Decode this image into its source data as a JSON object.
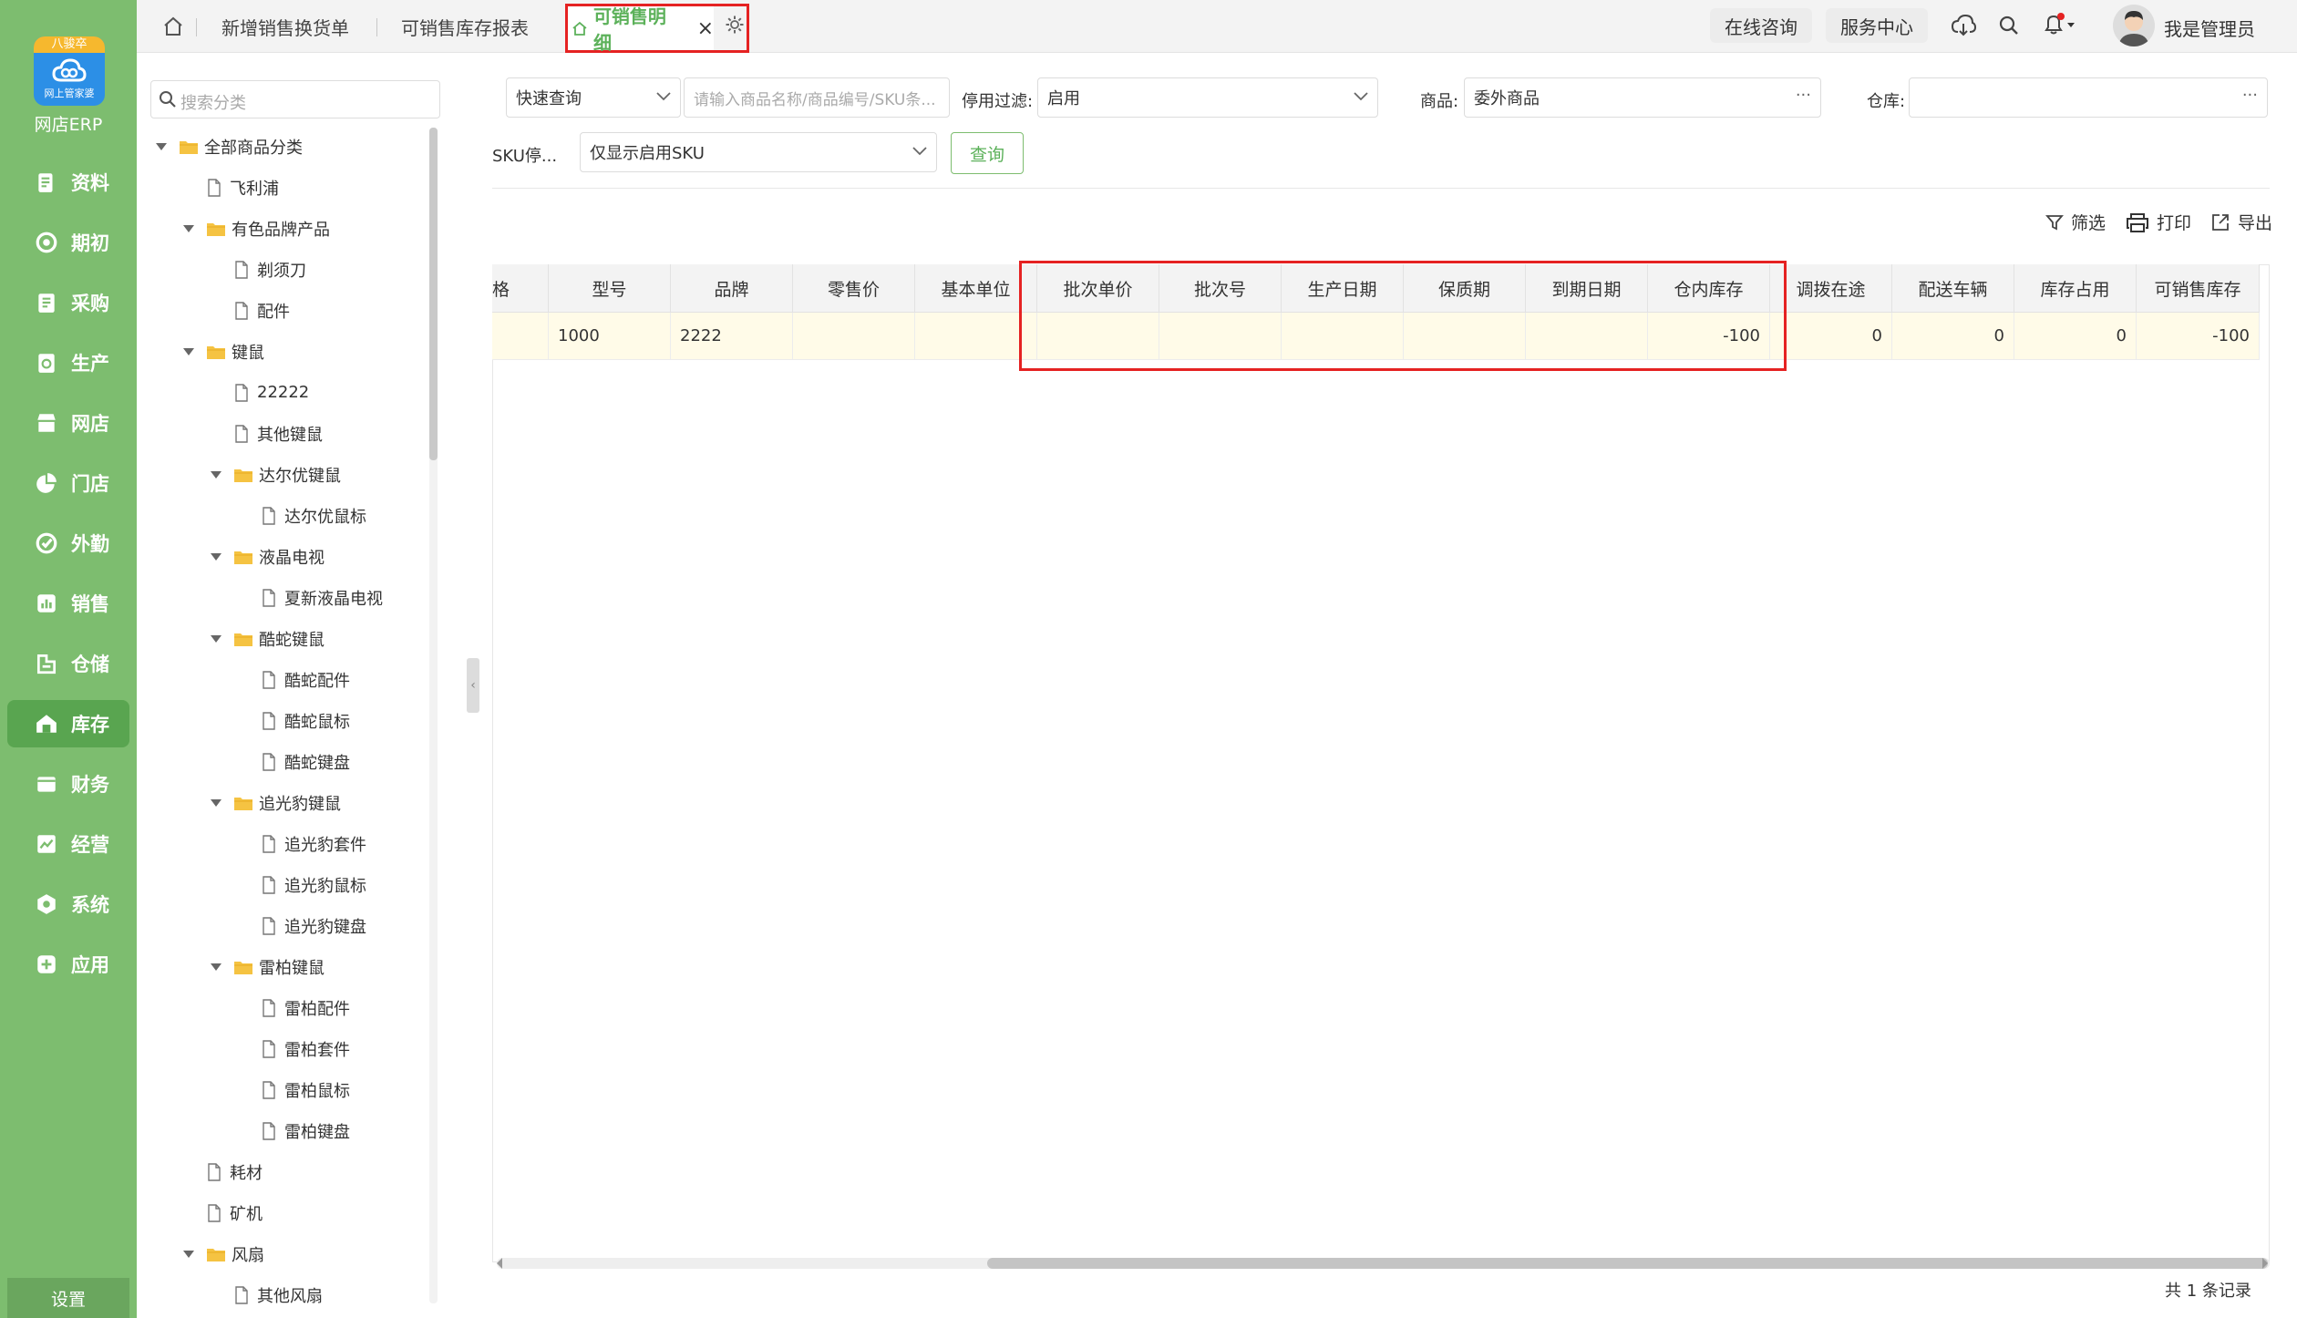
{
  "app": {
    "logo_top": "八骏卒",
    "logo_sub": "网上管家婆",
    "name": "网店ERP"
  },
  "nav": [
    {
      "label": "资料",
      "icon": "document-icon"
    },
    {
      "label": "期初",
      "icon": "target-icon"
    },
    {
      "label": "采购",
      "icon": "purchase-icon"
    },
    {
      "label": "生产",
      "icon": "production-icon"
    },
    {
      "label": "网店",
      "icon": "store-icon"
    },
    {
      "label": "门店",
      "icon": "pie-icon"
    },
    {
      "label": "外勤",
      "icon": "field-icon"
    },
    {
      "label": "销售",
      "icon": "sales-chart-icon"
    },
    {
      "label": "仓储",
      "icon": "warehouse-icon"
    },
    {
      "label": "库存",
      "icon": "inventory-icon",
      "active": true
    },
    {
      "label": "财务",
      "icon": "finance-icon"
    },
    {
      "label": "经营",
      "icon": "business-icon"
    },
    {
      "label": "系统",
      "icon": "system-icon"
    },
    {
      "label": "应用",
      "icon": "apps-icon"
    }
  ],
  "nav_settings": "设置",
  "tabs": [
    {
      "label": "新增销售换货单"
    },
    {
      "label": "可销售库存报表"
    },
    {
      "label": "可销售明细",
      "active": true
    }
  ],
  "header": {
    "consult": "在线咨询",
    "service": "服务中心",
    "user": "我是管理员"
  },
  "tree": {
    "search_placeholder": "搜索分类",
    "items": [
      {
        "label": "全部商品分类",
        "type": "folder",
        "level": 0,
        "expanded": true
      },
      {
        "label": "飞利浦",
        "type": "doc",
        "level": 1
      },
      {
        "label": "有色品牌产品",
        "type": "folder",
        "level": 1,
        "expanded": true
      },
      {
        "label": "剃须刀",
        "type": "doc",
        "level": 2
      },
      {
        "label": "配件",
        "type": "doc",
        "level": 2
      },
      {
        "label": "键鼠",
        "type": "folder",
        "level": 1,
        "expanded": true
      },
      {
        "label": "22222",
        "type": "doc",
        "level": 2
      },
      {
        "label": "其他键鼠",
        "type": "doc",
        "level": 2
      },
      {
        "label": "达尔优键鼠",
        "type": "folder",
        "level": 2,
        "expanded": true
      },
      {
        "label": "达尔优鼠标",
        "type": "doc",
        "level": 3
      },
      {
        "label": "液晶电视",
        "type": "folder",
        "level": 2,
        "expanded": true
      },
      {
        "label": "夏新液晶电视",
        "type": "doc",
        "level": 3
      },
      {
        "label": "酷蛇键鼠",
        "type": "folder",
        "level": 2,
        "expanded": true
      },
      {
        "label": "酷蛇配件",
        "type": "doc",
        "level": 3
      },
      {
        "label": "酷蛇鼠标",
        "type": "doc",
        "level": 3
      },
      {
        "label": "酷蛇键盘",
        "type": "doc",
        "level": 3
      },
      {
        "label": "追光豹键鼠",
        "type": "folder",
        "level": 2,
        "expanded": true
      },
      {
        "label": "追光豹套件",
        "type": "doc",
        "level": 3
      },
      {
        "label": "追光豹鼠标",
        "type": "doc",
        "level": 3
      },
      {
        "label": "追光豹键盘",
        "type": "doc",
        "level": 3
      },
      {
        "label": "雷柏键鼠",
        "type": "folder",
        "level": 2,
        "expanded": true
      },
      {
        "label": "雷柏配件",
        "type": "doc",
        "level": 3
      },
      {
        "label": "雷柏套件",
        "type": "doc",
        "level": 3
      },
      {
        "label": "雷柏鼠标",
        "type": "doc",
        "level": 3
      },
      {
        "label": "雷柏键盘",
        "type": "doc",
        "level": 3
      },
      {
        "label": "耗材",
        "type": "doc",
        "level": 1
      },
      {
        "label": "矿机",
        "type": "doc",
        "level": 1
      },
      {
        "label": "风扇",
        "type": "folder",
        "level": 1,
        "expanded": true
      },
      {
        "label": "其他风扇",
        "type": "doc",
        "level": 2
      }
    ]
  },
  "filters": {
    "quick_query": "快速查询",
    "search_placeholder": "请输入商品名称/商品编号/SKU条...",
    "disable_filter_label": "停用过滤:",
    "disable_filter_value": "启用",
    "product_label": "商品:",
    "product_value": "委外商品",
    "warehouse_label": "仓库:",
    "warehouse_value": "",
    "sku_label": "SKU停...",
    "sku_value": "仅显示启用SKU",
    "query_button": "查询"
  },
  "toolbar": {
    "filter": "筛选",
    "print": "打印",
    "export": "导出"
  },
  "table": {
    "columns": [
      "格",
      "型号",
      "品牌",
      "零售价",
      "基本单位",
      "批次单价",
      "批次号",
      "生产日期",
      "保质期",
      "到期日期",
      "仓内库存",
      "调拨在途",
      "配送车辆",
      "库存占用",
      "可销售库存"
    ],
    "rows": [
      [
        "",
        "1000",
        "2222",
        "",
        "",
        "",
        "",
        "",
        "",
        "",
        "-100",
        "0",
        "0",
        "0",
        "-100"
      ]
    ],
    "footer": "共 1 条记录"
  },
  "colors": {
    "nav_bg": "#7dbd6f",
    "accent": "#5cb15a",
    "highlight": "#e52222",
    "row_bg": "#fffbe8"
  }
}
